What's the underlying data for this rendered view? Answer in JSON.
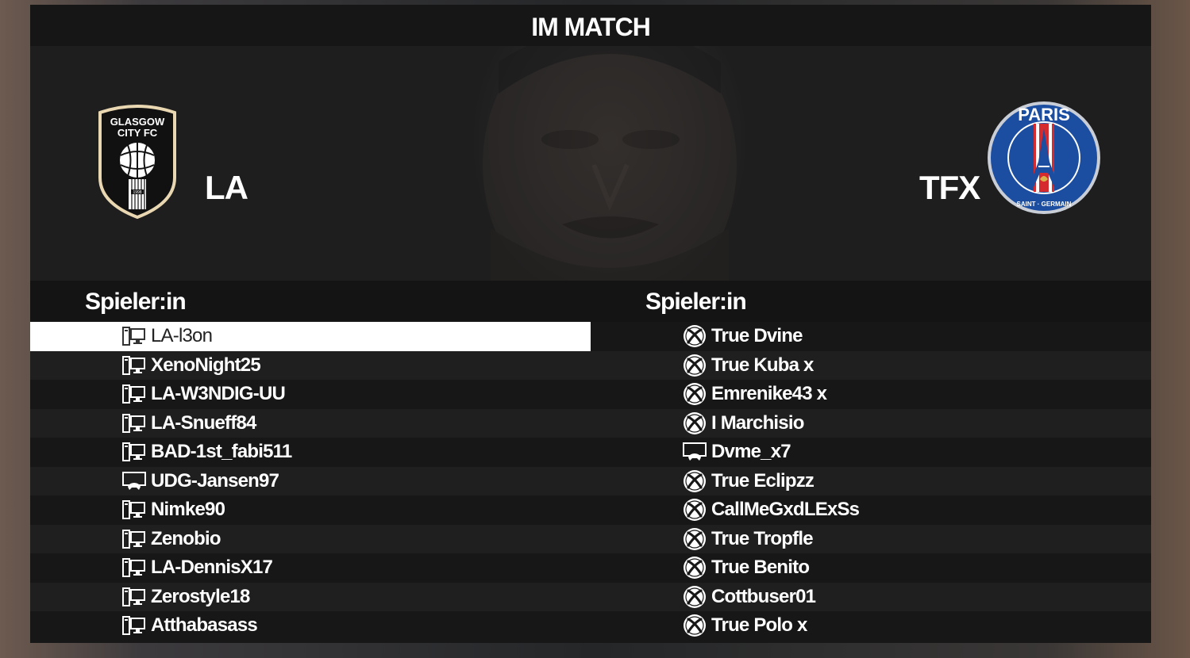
{
  "title": "IM MATCH",
  "home_team": {
    "name": "LA",
    "crest_text": [
      "GLASGOW",
      "CITY FC"
    ],
    "crest_year": "1998"
  },
  "away_team": {
    "name": "TFX",
    "crest_text": "PARIS",
    "crest_subtext": "SAINT · GERMAIN"
  },
  "column_header_left": "Spieler:in",
  "column_header_right": "Spieler:in",
  "home_players": [
    {
      "name": "LA-l3on",
      "platform": "pc-icon",
      "selected": true
    },
    {
      "name": "XenoNight25",
      "platform": "pc-icon"
    },
    {
      "name": "LA-W3NDIG-UU",
      "platform": "pc-icon"
    },
    {
      "name": "LA-Snueff84",
      "platform": "pc-icon"
    },
    {
      "name": "BAD-1st_fabi511",
      "platform": "pc-icon"
    },
    {
      "name": "UDG-Jansen97",
      "platform": "console-icon"
    },
    {
      "name": "Nimke90",
      "platform": "pc-icon"
    },
    {
      "name": "Zenobio",
      "platform": "pc-icon"
    },
    {
      "name": "LA-DennisX17",
      "platform": "pc-icon"
    },
    {
      "name": "Zerostyle18",
      "platform": "pc-icon"
    },
    {
      "name": "Atthabasass",
      "platform": "pc-icon"
    }
  ],
  "away_players": [
    {
      "name": "True Dvine",
      "platform": "xbox-icon"
    },
    {
      "name": "True Kuba x",
      "platform": "xbox-icon"
    },
    {
      "name": "Emrenike43 x",
      "platform": "xbox-icon"
    },
    {
      "name": "I Marchisio",
      "platform": "xbox-icon"
    },
    {
      "name": "Dvme_x7",
      "platform": "console-icon"
    },
    {
      "name": "True Eclipzz",
      "platform": "xbox-icon"
    },
    {
      "name": "CallMeGxdLExSs",
      "platform": "xbox-icon"
    },
    {
      "name": "True Tropfle",
      "platform": "xbox-icon"
    },
    {
      "name": "True Benito",
      "platform": "xbox-icon"
    },
    {
      "name": "Cottbuser01",
      "platform": "xbox-icon"
    },
    {
      "name": "True Polo x",
      "platform": "xbox-icon"
    }
  ],
  "colors": {
    "panel": "#171717",
    "row_odd": "#1f1f1f",
    "row_even": "#171717",
    "selected_row": "#ffffff",
    "psg_blue": "#1b4ea1",
    "psg_red": "#d52b2e",
    "glasgow_gold": "#e9d7b2"
  }
}
